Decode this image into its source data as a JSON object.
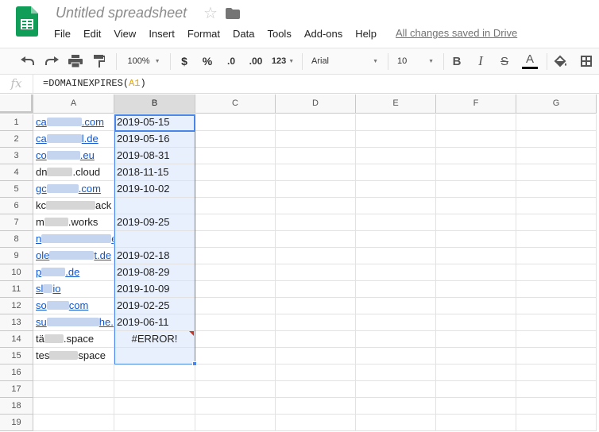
{
  "app": {
    "doc_title": "Untitled spreadsheet",
    "saved_status": "All changes saved in Drive",
    "menu": [
      "File",
      "Edit",
      "View",
      "Insert",
      "Format",
      "Data",
      "Tools",
      "Add-ons",
      "Help"
    ],
    "colors": {
      "link": "#1155cc",
      "selection": "#4a86e8",
      "logo": "#0f9d58"
    }
  },
  "toolbar": {
    "zoom": "100%",
    "currency": "$",
    "percent": "%",
    "decrease_decimals": ".0",
    "increase_decimals": ".00",
    "more_formats": "123",
    "font": "Arial",
    "font_size": "10",
    "bold": "B",
    "italic": "I",
    "strike": "S",
    "text_color": "A",
    "icons": [
      "undo-icon",
      "redo-icon",
      "print-icon",
      "paint-format-icon",
      "fill-color-icon",
      "borders-icon"
    ]
  },
  "formula_bar": {
    "fx": "fx",
    "prefix": "=DOMAINEXPIRES(",
    "ref": "A1",
    "suffix": ")"
  },
  "sheet": {
    "columns": [
      "A",
      "B",
      "C",
      "D",
      "E",
      "F",
      "G"
    ],
    "rows": [
      {
        "n": "1",
        "a_pre": "ca",
        "a_post": ".com",
        "a_link": true,
        "b": "2019-05-15"
      },
      {
        "n": "2",
        "a_pre": "ca",
        "a_post": "l.de",
        "a_link": true,
        "b": "2019-05-16"
      },
      {
        "n": "3",
        "a_pre": "co",
        "a_post": ".eu",
        "a_link": true,
        "b": "2019-08-31"
      },
      {
        "n": "4",
        "a_pre": "dn",
        "a_post": ".cloud",
        "a_link": false,
        "b": "2018-11-15"
      },
      {
        "n": "5",
        "a_pre": "gc",
        "a_post": ".com",
        "a_link": true,
        "b": "2019-10-02"
      },
      {
        "n": "6",
        "a_pre": "kc",
        "a_post": "ack",
        "a_link": false,
        "b": ""
      },
      {
        "n": "7",
        "a_pre": "m",
        "a_post": ".works",
        "a_link": false,
        "b": "2019-09-25"
      },
      {
        "n": "8",
        "a_pre": "n",
        "a_post": "es.",
        "a_link": true,
        "b": ""
      },
      {
        "n": "9",
        "a_pre": "ole",
        "a_post": "t.de",
        "a_link": true,
        "b": "2019-02-18"
      },
      {
        "n": "10",
        "a_pre": "p",
        "a_post": ".de",
        "a_link": true,
        "b": "2019-08-29"
      },
      {
        "n": "11",
        "a_pre": "sl",
        "a_post": "io",
        "a_link": true,
        "b": "2019-10-09"
      },
      {
        "n": "12",
        "a_pre": "so",
        "a_post": "com",
        "a_link": true,
        "b": "2019-02-25"
      },
      {
        "n": "13",
        "a_pre": "su",
        "a_post": "he.d",
        "a_link": true,
        "b": "2019-06-11"
      },
      {
        "n": "14",
        "a_pre": "tä",
        "a_post": ".space",
        "a_link": false,
        "b": "#ERROR!"
      },
      {
        "n": "15",
        "a_pre": "tes",
        "a_post": "space",
        "a_link": false,
        "b": ""
      },
      {
        "n": "16",
        "a_pre": "",
        "a_post": "",
        "a_link": false,
        "b": ""
      },
      {
        "n": "17",
        "a_pre": "",
        "a_post": "",
        "a_link": false,
        "b": ""
      },
      {
        "n": "18",
        "a_pre": "",
        "a_post": "",
        "a_link": false,
        "b": ""
      },
      {
        "n": "19",
        "a_pre": "",
        "a_post": "",
        "a_link": false,
        "b": ""
      }
    ]
  }
}
